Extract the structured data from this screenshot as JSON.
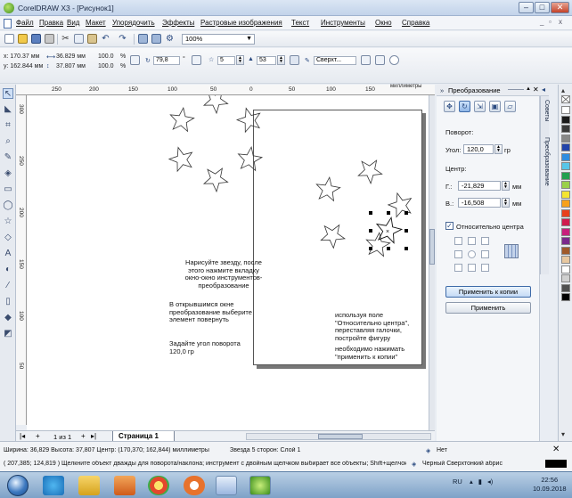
{
  "window": {
    "title": "CorelDRAW X3 - [Рисунок1]",
    "minimize": "–",
    "maximize": "□",
    "close": "✕"
  },
  "menu": [
    "Файл",
    "Правка",
    "Вид",
    "Макет",
    "Упорядочить",
    "Эффекты",
    "Растровые изображения",
    "Текст",
    "Инструменты",
    "Окно",
    "Справка"
  ],
  "toolbar": {
    "zoom": "100%"
  },
  "propbar": {
    "x": "x: 170.37 мм",
    "y": "y: 162.844 мм",
    "w": "36.829 мм",
    "h": "37.807 мм",
    "sx": "100.0",
    "sy": "100.0",
    "pct": "%",
    "angle": "79,8",
    "deg": "°",
    "points": "5",
    "sharpness": "53",
    "outline": "Сверхт..."
  },
  "ruler": {
    "h_ticks": [
      "250",
      "200",
      "150",
      "100",
      "50",
      "0",
      "50",
      "100",
      "150"
    ],
    "h_unit": "миллиметры",
    "v_ticks": [
      "300",
      "250",
      "200",
      "150",
      "100",
      "50"
    ]
  },
  "notes": {
    "n1": "Нарисуйте звезду, после\nэтого нажмите вкладку\nокно-окно инструментов-\nпреобразование",
    "n2": "В открывшимся окне\nпреобразование выберите\nэлемент повернуть",
    "n3": "Задайте угол поворота\n120,0 гр",
    "n4": "используя поле\n\"Относительно центра\",\nпереставляя галочки,\nпостройте фигуру",
    "n5": "необходимо нажимать\n\"применить к копии\""
  },
  "pagenav": {
    "counter": "1 из 1",
    "tab": "Страница 1"
  },
  "docker": {
    "title": "Преобразование",
    "rotation_label": "Поворот:",
    "angle_label": "Угол:",
    "angle_value": "120,0",
    "angle_unit": "гр",
    "center_label": "Центр:",
    "hx_label": "Г.:",
    "hx_value": "-21,829",
    "vy_label": "В.:",
    "vy_value": "-16,508",
    "unit": "мм",
    "relative_center": "Относительно центра",
    "apply_copy": "Применить к копии",
    "apply": "Применить",
    "tab1": "Советы",
    "tab2": "Преобразование"
  },
  "status": {
    "line1": "Ширина: 36,829 Высота: 37,807 Центр: (170,370; 162,844) миллиметры",
    "obj": "Звезда 5 сторон: Слой 1",
    "line2": "( 207,385; 124,819 )   Щелкните объект дважды для поворота/наклона; инструмент с двойным щелчком выбирает все объекты; Shift+щелчок - выбор н...",
    "fill": "Нет",
    "outline": "Черный  Сверхтонкий абрис"
  },
  "taskbar": {
    "lang": "RU",
    "time": "22:56",
    "date": "10.09.2018"
  },
  "palette": [
    "#ffffff",
    "#1a1a1a",
    "#3a3a3a",
    "#888888",
    "#2244aa",
    "#2e8de0",
    "#58c6e8",
    "#22a050",
    "#9ad14a",
    "#f4e531",
    "#f7a11a",
    "#e8401c",
    "#d01c4e",
    "#c8207c",
    "#7a2a8c",
    "#a05a2a",
    "#e8c8a0",
    "#ffffff",
    "#d0d0d0",
    "#505050",
    "#000000"
  ]
}
